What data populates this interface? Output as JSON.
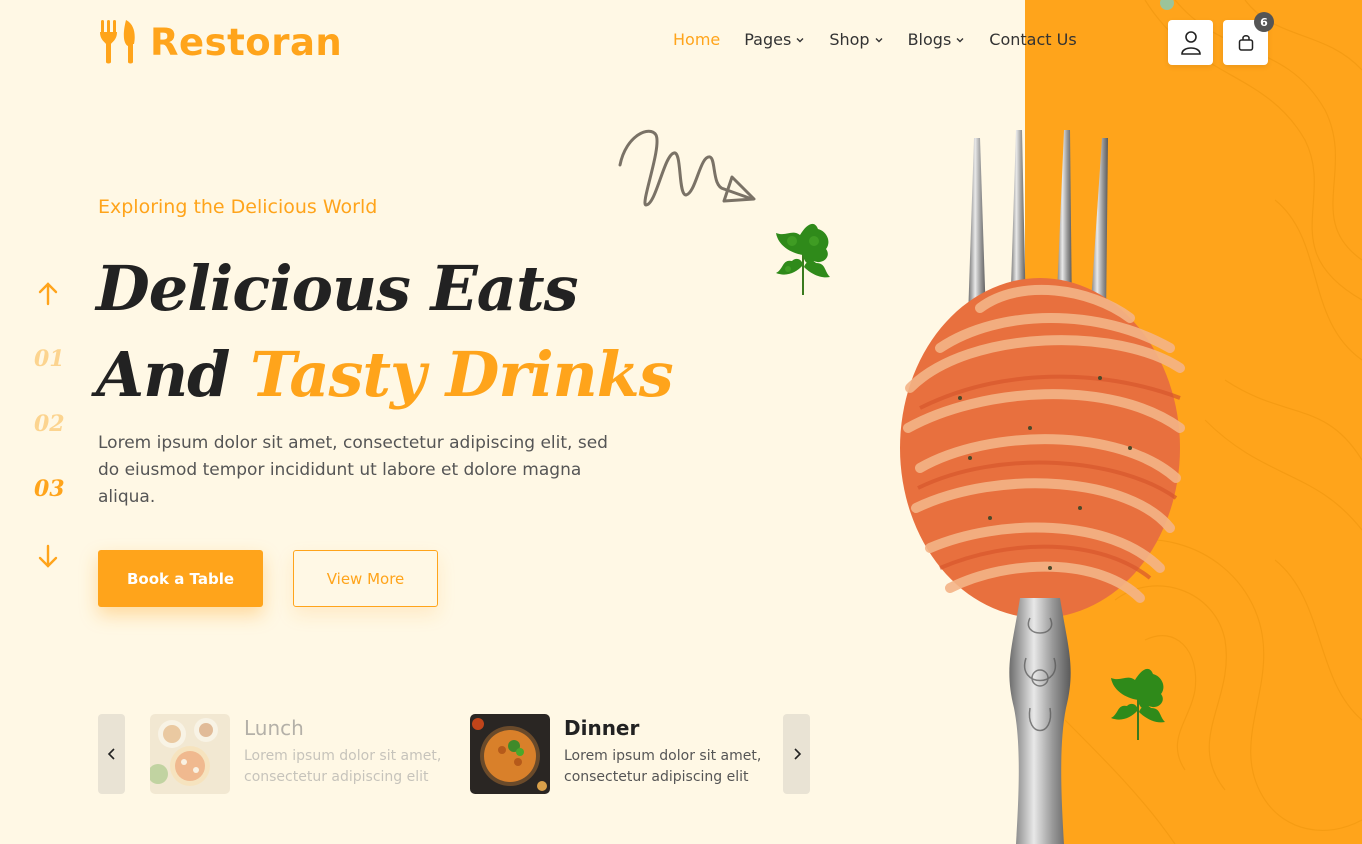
{
  "brand": {
    "name": "Restoran",
    "color": "#ffa41b"
  },
  "nav": {
    "items": [
      {
        "label": "Home",
        "active": true,
        "dropdown": false
      },
      {
        "label": "Pages",
        "active": false,
        "dropdown": true
      },
      {
        "label": "Shop",
        "active": false,
        "dropdown": true
      },
      {
        "label": "Blogs",
        "active": false,
        "dropdown": true
      },
      {
        "label": "Contact Us",
        "active": false,
        "dropdown": false
      }
    ],
    "user_icon": "user-icon",
    "cart_icon": "shopping-bag-icon",
    "cart_count": "6"
  },
  "slides": {
    "numbers": [
      "01",
      "02",
      "03"
    ],
    "active_index": 2
  },
  "hero": {
    "subtitle": "Exploring the Delicious World",
    "line1": "Delicious Eats",
    "line2_plain": "And",
    "line2_accent": "Tasty Drinks",
    "description": "Lorem ipsum dolor sit amet, consectetur adipiscing elit, sed do eiusmod tempor incididunt ut labore et dolore magna aliqua.",
    "primary_button": "Book a Table",
    "secondary_button": "View More"
  },
  "categories": [
    {
      "title": "Lunch",
      "description": "Lorem ipsum dolor sit amet, consectetur adipiscing elit",
      "active": false
    },
    {
      "title": "Dinner",
      "description": "Lorem ipsum dolor sit amet, consectetur adipiscing elit",
      "active": true
    }
  ],
  "colors": {
    "background": "#fff8e5",
    "accent": "#ffa41b",
    "text": "#222222"
  }
}
